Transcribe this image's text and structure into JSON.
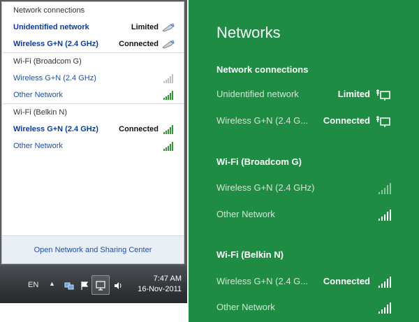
{
  "win7": {
    "header": "Network connections",
    "connections": [
      {
        "name": "Unidentified network",
        "status": "Limited"
      },
      {
        "name": "Wireless G+N (2.4 GHz)",
        "status": "Connected"
      }
    ],
    "adapter1": {
      "title": "Wi-Fi (Broadcom G)",
      "networks": [
        {
          "name": "Wireless G+N (2.4 GHz)",
          "status": ""
        },
        {
          "name": "Other Network",
          "status": ""
        }
      ]
    },
    "adapter2": {
      "title": "Wi-Fi (Belkin N)",
      "networks": [
        {
          "name": "Wireless G+N (2.4 GHz)",
          "status": "Connected"
        },
        {
          "name": "Other Network",
          "status": ""
        }
      ]
    },
    "footer_link": "Open Network and Sharing Center",
    "taskbar": {
      "language": "EN",
      "time": "7:47 AM",
      "date": "16-Nov-2011"
    }
  },
  "win8": {
    "title": "Networks",
    "header": "Network connections",
    "connections": [
      {
        "name": "Unidentified network",
        "status": "Limited"
      },
      {
        "name": "Wireless G+N (2.4 G...",
        "status": "Connected"
      }
    ],
    "adapter1": {
      "title": "Wi-Fi (Broadcom G)",
      "networks": [
        {
          "name": "Wireless G+N (2.4 GHz)",
          "status": ""
        },
        {
          "name": "Other Network",
          "status": ""
        }
      ]
    },
    "adapter2": {
      "title": "Wi-Fi (Belkin N)",
      "networks": [
        {
          "name": "Wireless G+N (2.4 G...",
          "status": "Connected"
        },
        {
          "name": "Other Network",
          "status": ""
        }
      ]
    }
  },
  "colors": {
    "win8_accent": "#1f8c44",
    "win7_link": "#1a4fb2"
  }
}
